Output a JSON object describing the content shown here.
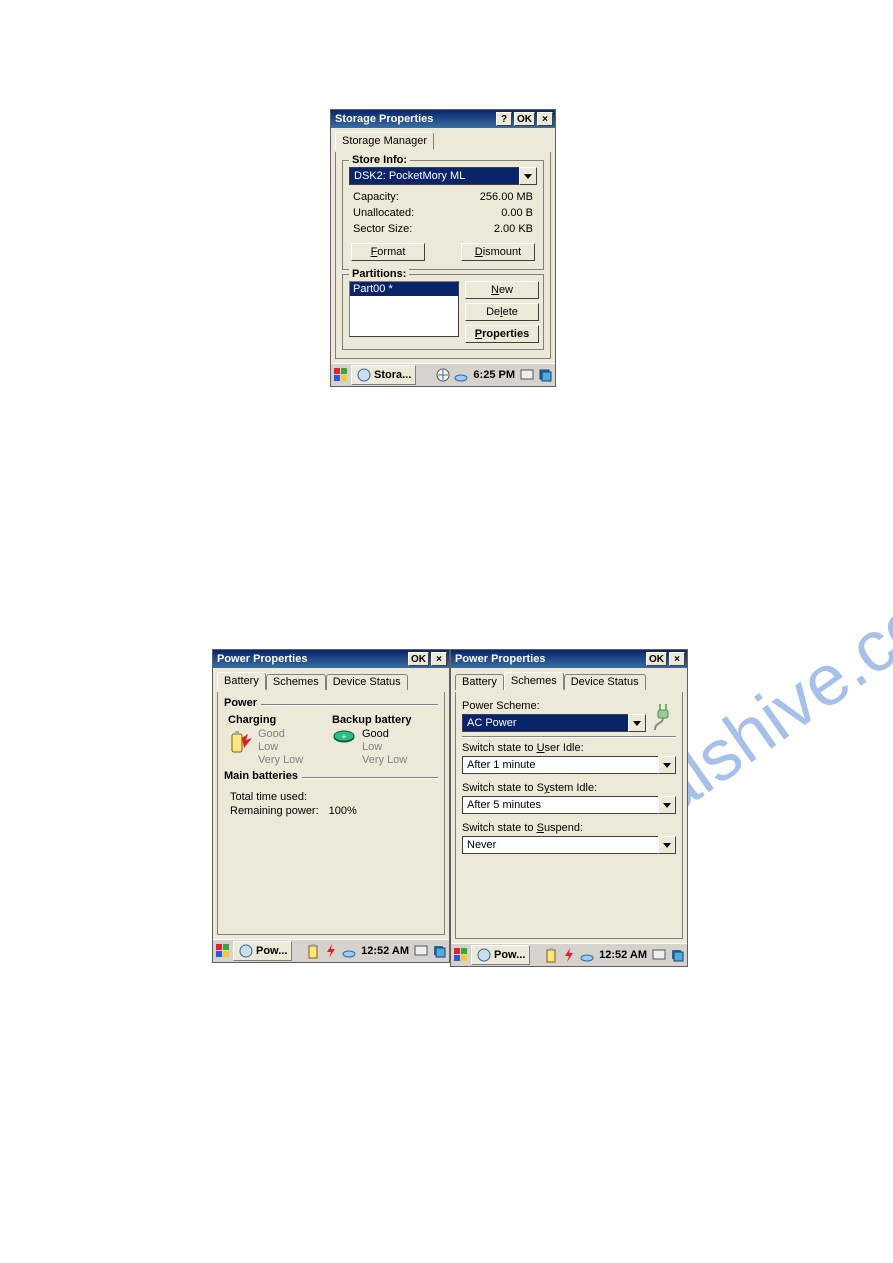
{
  "storage": {
    "title": "Storage Properties",
    "tab_label": "Storage Manager",
    "store_info": {
      "legend": "Store Info:",
      "selected": "DSK2: PocketMory ML",
      "rows": {
        "cap_label": "Capacity:",
        "cap_val": "256.00 MB",
        "unalloc_label": "Unallocated:",
        "unalloc_val": "0.00 B",
        "sector_label": "Sector Size:",
        "sector_val": "2.00 KB"
      },
      "format_btn": "Format",
      "dismount_btn": "Dismount"
    },
    "partitions": {
      "legend": "Partitions:",
      "item": "Part00 *",
      "new_btn": "New",
      "delete_btn": "Delete",
      "properties_btn": "Properties"
    },
    "taskbar": {
      "task": "Stora...",
      "time": "6:25 PM"
    },
    "tb": {
      "help": "?",
      "ok": "OK",
      "close": "×"
    }
  },
  "power1": {
    "title": "Power Properties",
    "tabs": {
      "battery": "Battery",
      "schemes": "Schemes",
      "device": "Device Status"
    },
    "power_legend": "Power",
    "charging_label": "Charging",
    "backup_label": "Backup battery",
    "levels": {
      "good": "Good",
      "low": "Low",
      "verylow": "Very Low"
    },
    "main_legend": "Main batteries",
    "total_label": "Total time used:",
    "remaining_label": "Remaining power:",
    "remaining_val": "100%",
    "taskbar": {
      "task": "Pow...",
      "time": "12:52 AM"
    },
    "tb": {
      "ok": "OK",
      "close": "×"
    }
  },
  "power2": {
    "title": "Power Properties",
    "tabs": {
      "battery": "Battery",
      "schemes": "Schemes",
      "device": "Device Status"
    },
    "scheme_label": "Power Scheme:",
    "scheme_value": "AC Power",
    "user_idle_label": "Switch state to User Idle:",
    "user_idle_value": "After 1 minute",
    "system_idle_label": "Switch state to System Idle:",
    "system_idle_value": "After 5 minutes",
    "suspend_label": "Switch state to Suspend:",
    "suspend_value": "Never",
    "taskbar": {
      "task": "Pow...",
      "time": "12:52 AM"
    },
    "tb": {
      "ok": "OK",
      "close": "×"
    }
  }
}
